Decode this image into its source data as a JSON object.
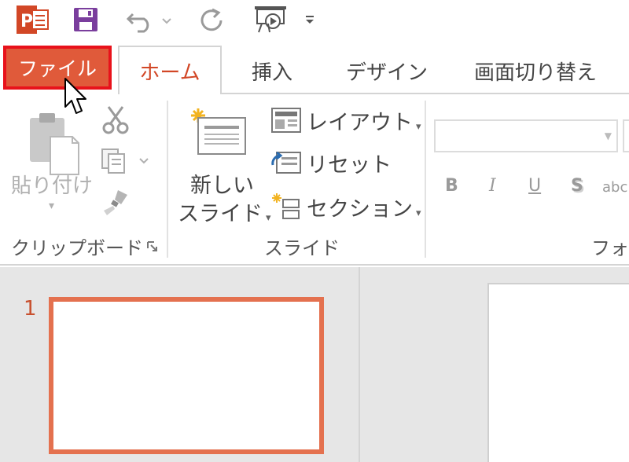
{
  "quick_access": {
    "app_icon": "powerpoint-icon",
    "app_letter": "P",
    "save_icon": "save-icon",
    "undo_icon": "undo-icon",
    "redo_icon": "redo-icon",
    "slideshow_icon": "slideshow-from-beginning-icon",
    "more_glyph": "₹"
  },
  "tabs": [
    {
      "label": "ファイル",
      "selected": false
    },
    {
      "label": "ホーム",
      "selected": true
    },
    {
      "label": "挿入",
      "selected": false
    },
    {
      "label": "デザイン",
      "selected": false
    },
    {
      "label": "画面切り替え",
      "selected": false
    }
  ],
  "ribbon": {
    "clipboard": {
      "paste_label": "貼り付け",
      "paste_dropdown": "▾",
      "group_label": "クリップボード",
      "cut_icon": "scissors-icon",
      "copy_icon": "copy-icon",
      "format_painter_icon": "format-painter-icon",
      "launcher_icon": "dialog-launcher-icon"
    },
    "slides": {
      "new_slide_line1": "新しい",
      "new_slide_line2": "スライド",
      "layout_label": "レイアウト",
      "reset_label": "リセット",
      "section_label": "セクション",
      "group_label": "スライド",
      "dropdown": "▾"
    },
    "font": {
      "bold": "B",
      "italic": "I",
      "underline": "U",
      "shadow": "S",
      "strikethrough": "abc",
      "group_label": "フォン"
    }
  },
  "slides_pane": {
    "slide_number": "1"
  },
  "colors": {
    "accent": "#d24726",
    "file_tab_bg": "#e05a3a",
    "highlight_border": "#e8121b",
    "thumb_border": "#e4714f",
    "save_purple": "#7a3e9d",
    "workarea_bg": "#e6e6e6"
  }
}
